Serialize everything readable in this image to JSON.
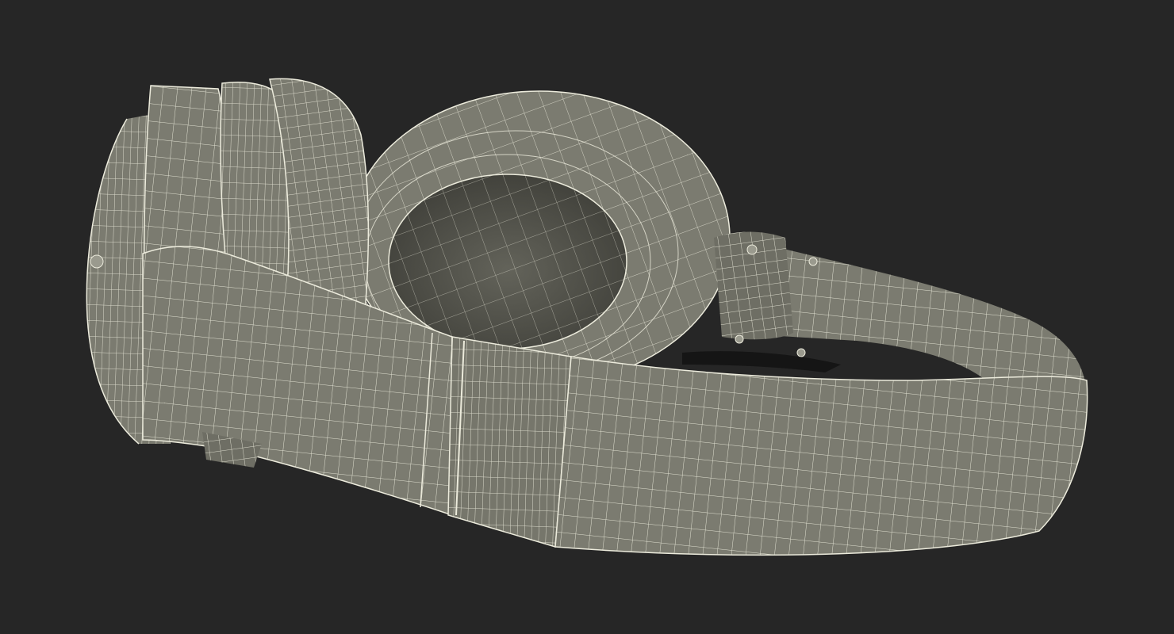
{
  "scene": {
    "subject": "headphones-wireframe-render",
    "colors": {
      "background": "#262626",
      "surface": "#7b7b70",
      "surface_light": "#8a8a7f",
      "surface_dark": "#5f5f57",
      "cavity": "#54544c",
      "wire": "#ecebdc",
      "shadow_gap": "#151515"
    }
  }
}
